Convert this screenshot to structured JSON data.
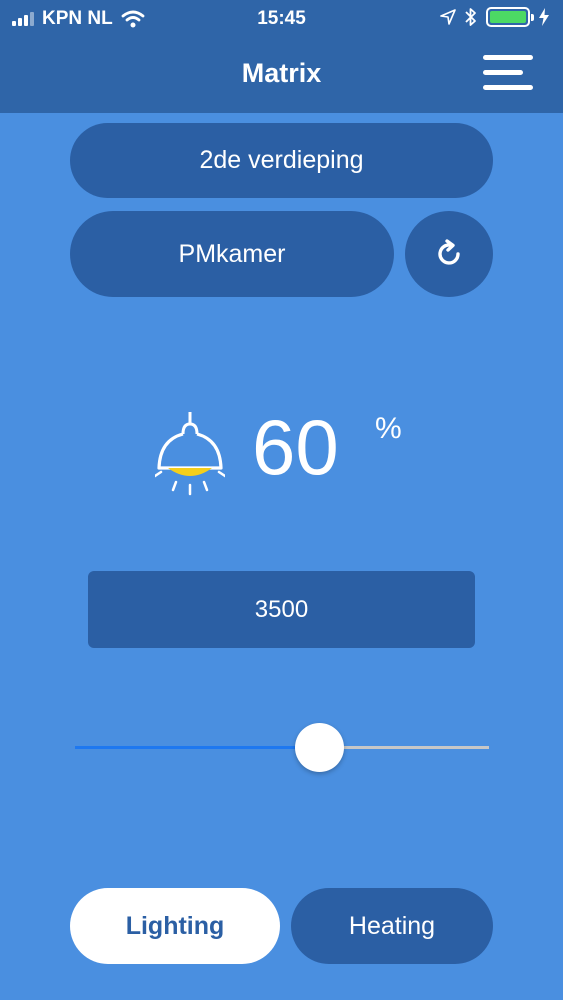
{
  "status_bar": {
    "carrier": "KPN NL",
    "time": "15:45",
    "battery_color": "#4cd964"
  },
  "header": {
    "title": "Matrix",
    "menu_icon": "hamburger-menu-icon"
  },
  "selectors": {
    "floor": "2de verdieping",
    "room": "PMkamer",
    "refresh_icon": "refresh-icon"
  },
  "reading": {
    "icon": "ceiling-lamp-icon",
    "value": "60",
    "unit": "%"
  },
  "setting": {
    "value": "3500"
  },
  "slider": {
    "level_fraction": 0.59
  },
  "tabs": [
    {
      "label": "Lighting",
      "active": true
    },
    {
      "label": "Heating",
      "active": false
    }
  ],
  "colors": {
    "background": "#4a8fe0",
    "bar": "#2f65a8",
    "button": "#2b5fa4",
    "slider_active": "#1e78f0",
    "lamp_light": "#f5cf1b"
  }
}
